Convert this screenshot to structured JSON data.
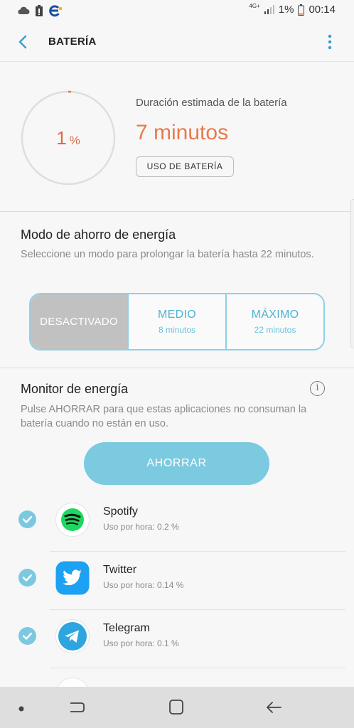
{
  "status_bar": {
    "battery_percent": "1%",
    "time": "00:14",
    "network": "4G+"
  },
  "header": {
    "title": "BATERÍA"
  },
  "battery": {
    "percent_value": "1",
    "percent_unit": "%",
    "level": 0.01,
    "duration_label": "Duración estimada de la batería",
    "duration_value": "7 minutos",
    "usage_button": "USO DE BATERÍA"
  },
  "power_saving": {
    "title": "Modo de ahorro de energía",
    "description": "Seleccione un modo para prolongar la batería hasta 22 minutos.",
    "modes": [
      {
        "name": "DESACTIVADO",
        "sub": "",
        "active": true
      },
      {
        "name": "MEDIO",
        "sub": "8 minutos",
        "active": false
      },
      {
        "name": "MÁXIMO",
        "sub": "22 minutos",
        "active": false
      }
    ]
  },
  "monitor": {
    "title": "Monitor de energía",
    "info_icon": "i",
    "description": "Pulse AHORRAR para que estas aplicaciones no consuman la batería cuando no están en uso.",
    "save_button": "AHORRAR",
    "apps": [
      {
        "name": "Spotify",
        "usage": "Uso por hora: 0.2 %",
        "icon": "spotify-icon",
        "checked": true
      },
      {
        "name": "Twitter",
        "usage": "Uso por hora: 0.14 %",
        "icon": "twitter-icon",
        "checked": true
      },
      {
        "name": "Telegram",
        "usage": "Uso por hora: 0.1 %",
        "icon": "telegram-icon",
        "checked": true
      }
    ]
  },
  "colors": {
    "accent": "#7ccae0",
    "orange": "#e87a4c",
    "segment_border": "#8ed0e6"
  }
}
